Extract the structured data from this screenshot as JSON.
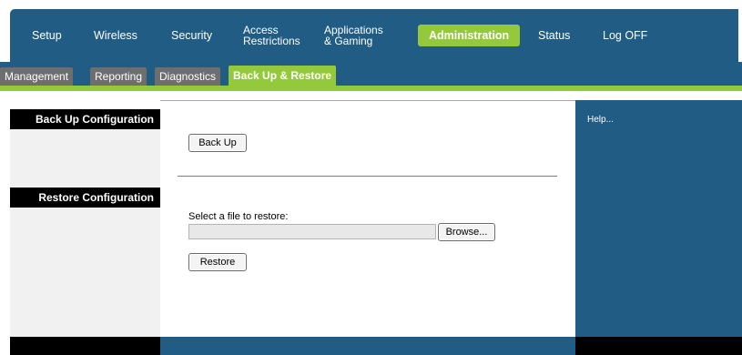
{
  "nav": {
    "items": [
      {
        "label": "Setup"
      },
      {
        "label": "Wireless"
      },
      {
        "label": "Security"
      },
      {
        "label": "Access\nRestrictions"
      },
      {
        "label": "Applications\n& Gaming"
      },
      {
        "label": "Administration"
      },
      {
        "label": "Status"
      },
      {
        "label": "Log OFF"
      }
    ],
    "active": "Administration"
  },
  "subnav": {
    "tabs": [
      {
        "label": "Management"
      },
      {
        "label": "Reporting"
      },
      {
        "label": "Diagnostics"
      },
      {
        "label": "Back Up & Restore"
      }
    ],
    "active": "Back Up & Restore"
  },
  "left": {
    "backup_heading": "Back Up Configuration",
    "restore_heading": "Restore Configuration"
  },
  "main": {
    "backup_button": "Back Up",
    "select_label": "Select a file to restore:",
    "file_value": "",
    "browse_button": "Browse...",
    "restore_button": "Restore"
  },
  "help": {
    "text": "Help..."
  },
  "colors": {
    "nav_blue": "#215c84",
    "accent_green": "#94c93c",
    "tab_gray": "#6e6e6e"
  }
}
